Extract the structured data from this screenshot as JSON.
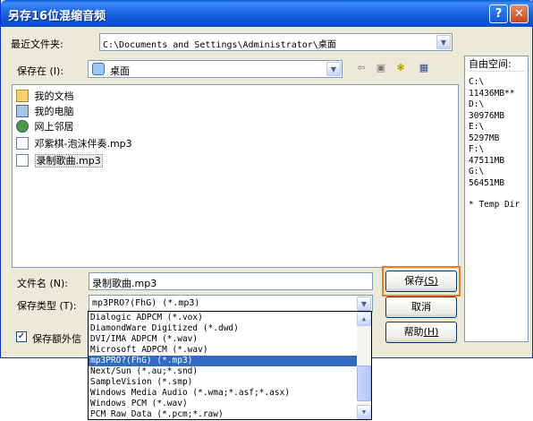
{
  "window": {
    "title": "另存16位混缩音频",
    "help_glyph": "?",
    "close_glyph": "✕"
  },
  "recent": {
    "label": "最近文件夹:",
    "value": "C:\\Documents and Settings\\Administrator\\桌面"
  },
  "save_in": {
    "label": "保存在 (I):",
    "value": "桌面"
  },
  "files": [
    {
      "name": "我的文档",
      "icon": "folder-icon"
    },
    {
      "name": "我的电脑",
      "icon": "computer-icon"
    },
    {
      "name": "网上邻居",
      "icon": "network-icon"
    },
    {
      "name": "邓紫棋-泡沫伴奏.mp3",
      "icon": "audio-file-icon"
    },
    {
      "name": "录制歌曲.mp3",
      "icon": "audio-file-icon"
    }
  ],
  "free_space": {
    "header": "自由空间:",
    "lines": [
      "C:\\",
      "11436MB**",
      "D:\\",
      "30976MB",
      "E:\\",
      "5297MB",
      "F:\\",
      "47511MB",
      "G:\\",
      "56451MB",
      "",
      "* Temp Dir"
    ]
  },
  "filename": {
    "label": "文件名 (N):",
    "value": "录制歌曲.mp3"
  },
  "filetype": {
    "label": "保存类型 (T):",
    "value": "mp3PRO?(FhG) (*.mp3)",
    "options": [
      "Dialogic ADPCM (*.vox)",
      "DiamondWare Digitized (*.dwd)",
      "DVI/IMA ADPCM (*.wav)",
      "Microsoft ADPCM (*.wav)",
      "mp3PRO?(FhG) (*.mp3)",
      "Next/Sun (*.au;*.snd)",
      "SampleVision (*.smp)",
      "Windows Media Audio (*.wma;*.asf;*.asx)",
      "Windows PCM (*.wav)",
      "PCM Raw Data (*.pcm;*.raw)"
    ],
    "selected_index": 4
  },
  "buttons": {
    "save": "保存",
    "save_key": "(S)",
    "cancel": "取消",
    "help": "帮助",
    "help_key": "(H)"
  },
  "checkbox": {
    "label": "保存额外信",
    "checked": true,
    "check_glyph": "✓"
  },
  "toolbar": {
    "back_glyph": "⇦",
    "up_glyph": "▣",
    "newfolder_glyph": "✱",
    "view_glyph": "▦"
  }
}
